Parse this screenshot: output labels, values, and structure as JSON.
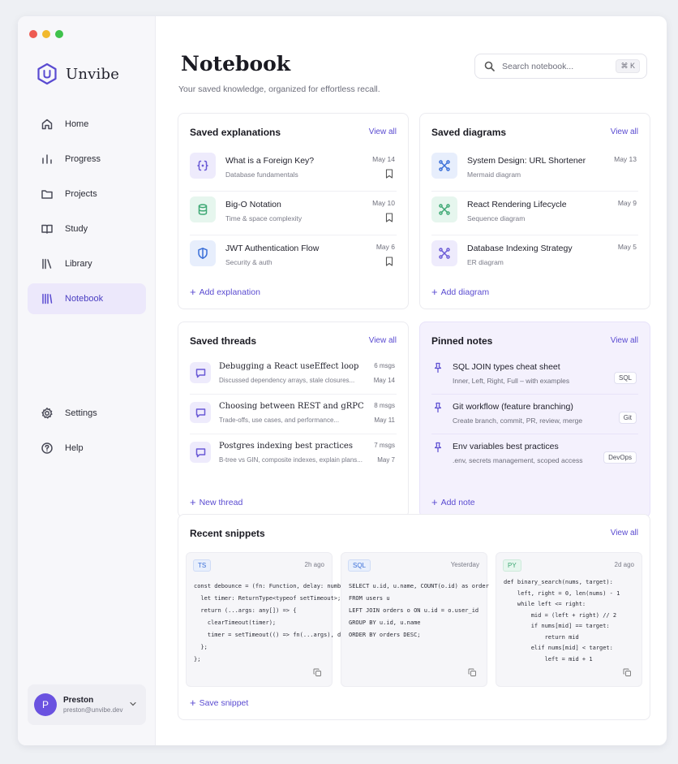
{
  "app": {
    "name": "Unvibe",
    "brand_color": "#5a4bd1"
  },
  "sidebar": {
    "items": [
      {
        "label": "Home",
        "icon": "home-icon"
      },
      {
        "label": "Progress",
        "icon": "bar-chart-icon"
      },
      {
        "label": "Projects",
        "icon": "folder-icon"
      },
      {
        "label": "Study",
        "icon": "book-open-icon"
      },
      {
        "label": "Library",
        "icon": "library-icon"
      },
      {
        "label": "Notebook",
        "icon": "notebook-icon",
        "active": true
      }
    ],
    "bottom_items": [
      {
        "label": "Settings",
        "icon": "gear-icon"
      },
      {
        "label": "Help",
        "icon": "help-circle-icon"
      }
    ],
    "user": {
      "initial": "P",
      "name": "Preston",
      "email": "preston@unvibe.dev"
    }
  },
  "header": {
    "title": "Notebook",
    "subtitle": "Your saved knowledge, organized for effortless recall.",
    "search_placeholder": "Search notebook...",
    "search_shortcut": "⌘ K"
  },
  "explanations": {
    "title": "Saved explanations",
    "view_all": "View all",
    "add_label": "Add explanation",
    "items": [
      {
        "title": "What is a Foreign Key?",
        "subtitle": "Database fundamentals",
        "date": "May 14",
        "icon": "braces-icon"
      },
      {
        "title": "Big-O Notation",
        "subtitle": "Time & space complexity",
        "date": "May 10",
        "icon": "database-icon"
      },
      {
        "title": "JWT Authentication Flow",
        "subtitle": "Security & auth",
        "date": "May 6",
        "icon": "shield-icon"
      }
    ]
  },
  "diagrams": {
    "title": "Saved diagrams",
    "view_all": "View all",
    "add_label": "Add diagram",
    "items": [
      {
        "title": "System Design: URL Shortener",
        "subtitle": "Mermaid diagram",
        "date": "May 13",
        "icon": "diagram-icon"
      },
      {
        "title": "React Rendering Lifecycle",
        "subtitle": "Sequence diagram",
        "date": "May 9",
        "icon": "diagram-icon"
      },
      {
        "title": "Database Indexing Strategy",
        "subtitle": "ER diagram",
        "date": "May 5",
        "icon": "diagram-icon"
      }
    ]
  },
  "threads": {
    "title": "Saved threads",
    "view_all": "View all",
    "add_label": "New thread",
    "items": [
      {
        "title": "Debugging a React useEffect loop",
        "subtitle": "Discussed dependency arrays, stale closures...",
        "count": "6 msgs",
        "date": "May 14"
      },
      {
        "title": "Choosing between REST and gRPC",
        "subtitle": "Trade-offs, use cases, and performance...",
        "count": "8 msgs",
        "date": "May 11"
      },
      {
        "title": "Postgres indexing best practices",
        "subtitle": "B-tree vs GIN, composite indexes, explain plans...",
        "count": "7 msgs",
        "date": "May 7"
      }
    ]
  },
  "pinned": {
    "title": "Pinned notes",
    "view_all": "View all",
    "add_label": "Add note",
    "items": [
      {
        "title": "SQL JOIN types cheat sheet",
        "subtitle": "Inner, Left, Right, Full – with examples",
        "tag": "SQL"
      },
      {
        "title": "Git workflow (feature branching)",
        "subtitle": "Create branch, commit, PR, review, merge",
        "tag": "Git"
      },
      {
        "title": "Env variables best practices",
        "subtitle": ".env, secrets management, scoped access",
        "tag": "DevOps"
      }
    ]
  },
  "snippets": {
    "title": "Recent snippets",
    "view_all": "View all",
    "add_label": "Save snippet",
    "items": [
      {
        "lang": "TS",
        "time": "2h ago",
        "lines": [
          "const debounce = (fn: Function, delay: number) =>",
          "  let timer: ReturnType<typeof setTimeout>;",
          "  return (...args: any[]) => {",
          "    clearTimeout(timer);",
          "    timer = setTimeout(() => fn(...args), delay);",
          "  };",
          "};"
        ]
      },
      {
        "lang": "SQL",
        "time": "Yesterday",
        "lines": [
          "SELECT u.id, u.name, COUNT(o.id) as order",
          "FROM users u",
          "LEFT JOIN orders o ON u.id = o.user_id",
          "GROUP BY u.id, u.name",
          "ORDER BY orders DESC;"
        ]
      },
      {
        "lang": "PY",
        "time": "2d ago",
        "lines": [
          "def binary_search(nums, target):",
          "    left, right = 0, len(nums) - 1",
          "    while left <= right:",
          "        mid = (left + right) // 2",
          "        if nums[mid] == target:",
          "            return mid",
          "        elif nums[mid] < target:",
          "            left = mid + 1"
        ]
      }
    ]
  }
}
